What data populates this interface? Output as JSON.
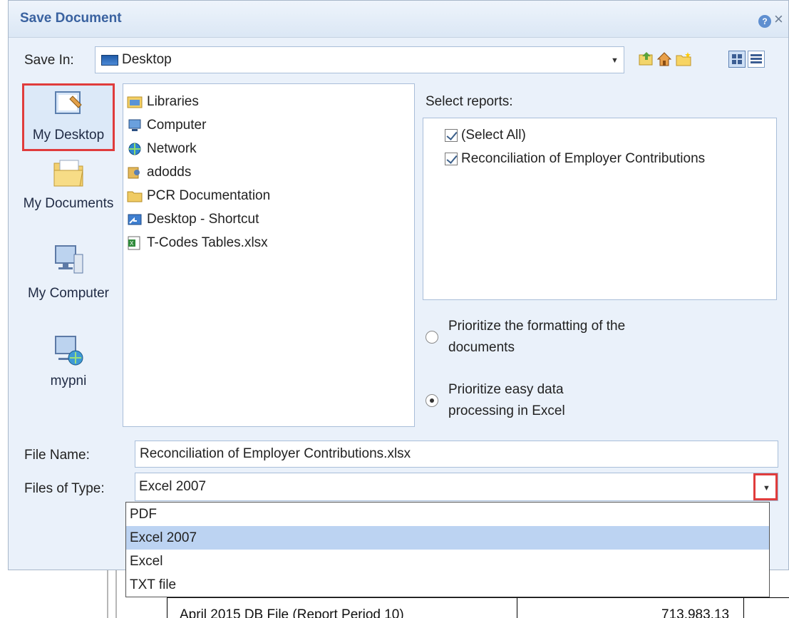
{
  "dialog": {
    "title": "Save Document",
    "help_icon": "help-icon",
    "close_icon": "close-icon"
  },
  "save_in": {
    "label": "Save In:",
    "value": "Desktop"
  },
  "toolbar": {
    "icons": [
      "up-folder-icon",
      "home-icon",
      "new-folder-icon",
      "thumbnails-view-icon",
      "details-view-icon"
    ]
  },
  "places": [
    {
      "label": "My Desktop",
      "icon": "desktop-icon",
      "selected": true
    },
    {
      "label": "My Documents",
      "icon": "documents-folder-icon",
      "selected": false
    },
    {
      "label": "My Computer",
      "icon": "computer-icon",
      "selected": false
    },
    {
      "label": "mypni",
      "icon": "network-computer-icon",
      "selected": false
    }
  ],
  "files": [
    {
      "name": "Libraries",
      "icon": "libraries-icon"
    },
    {
      "name": "Computer",
      "icon": "computer-icon"
    },
    {
      "name": "Network",
      "icon": "network-icon"
    },
    {
      "name": "adodds",
      "icon": "user-folder-icon"
    },
    {
      "name": "PCR Documentation",
      "icon": "folder-icon"
    },
    {
      "name": "Desktop - Shortcut",
      "icon": "shortcut-icon"
    },
    {
      "name": "T-Codes  Tables.xlsx",
      "icon": "excel-file-icon"
    }
  ],
  "reports": {
    "label": "Select reports:",
    "items": [
      {
        "label": "(Select All)",
        "checked": true
      },
      {
        "label": "Reconciliation of Employer Contributions",
        "checked": true
      }
    ]
  },
  "options": [
    {
      "label_line1": "Prioritize the formatting of the",
      "label_line2": "documents",
      "selected": false
    },
    {
      "label_line1": "Prioritize easy data",
      "label_line2": "processing in Excel",
      "selected": true
    }
  ],
  "file_name": {
    "label": "File Name:",
    "value": "Reconciliation of Employer Contributions.xlsx"
  },
  "file_type": {
    "label": "Files of Type:",
    "value": "Excel 2007",
    "options": [
      "PDF",
      "Excel 2007",
      "Excel",
      "TXT file"
    ]
  },
  "background": {
    "row_label": "April 2015 DB File (Report Period 10)",
    "row_value": "713,983.13"
  },
  "colors": {
    "title": "#3a62a0",
    "highlight_border": "#e03c3c",
    "selected_option": "#bcd3f2",
    "dialog_bg": "#eaf1fa"
  }
}
